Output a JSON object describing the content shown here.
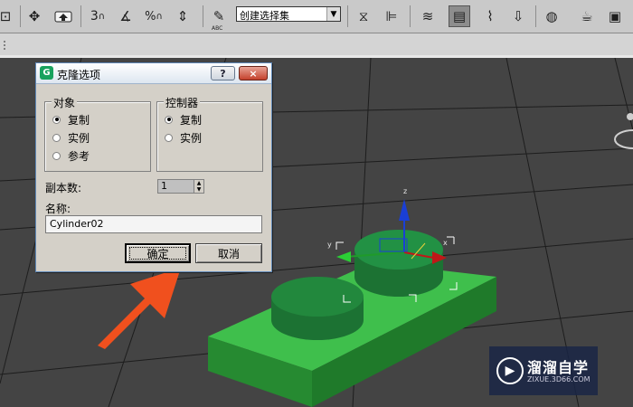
{
  "toolbar": {
    "selection_set_value": "创建选择集",
    "icons": [
      "undo-icon",
      "select-move-icon",
      "select-and-link-icon",
      "snap-3d-icon",
      "angle-snap-icon",
      "percent-snap-icon",
      "spinner-snap-icon",
      "edit-named-sets-icon",
      "mirror-icon",
      "align-icon",
      "layer-manager-icon",
      "scene-explorer-icon",
      "curve-editor-icon",
      "schematic-view-icon",
      "material-editor-icon",
      "render-setup-icon",
      "render-icon"
    ]
  },
  "dialog": {
    "title": "克隆选项",
    "help_label": "?",
    "close_label": "×",
    "object_group": {
      "label": "对象",
      "options": [
        "复制",
        "实例",
        "参考"
      ],
      "selected": "复制"
    },
    "controller_group": {
      "label": "控制器",
      "options": [
        "复制",
        "实例"
      ],
      "selected": "复制"
    },
    "copies_label": "副本数:",
    "copies_value": "1",
    "name_label": "名称:",
    "name_value": "Cylinder02",
    "ok_label": "确定",
    "cancel_label": "取消"
  },
  "viewport": {
    "gizmo": {
      "z_label": "z",
      "y_label": "y",
      "x_label": "x"
    }
  },
  "watermark": {
    "name": "溜溜自学",
    "url": "ZIXUE.3D66.COM"
  },
  "colors": {
    "toolbar_bg": "#c9c9c9",
    "viewport_bg": "#444444",
    "dialog_bg": "#d4d0c8",
    "object_green": "#2fa63d",
    "arrow_orange": "#f0501e",
    "gizmo_blue": "#1a3fd6"
  }
}
